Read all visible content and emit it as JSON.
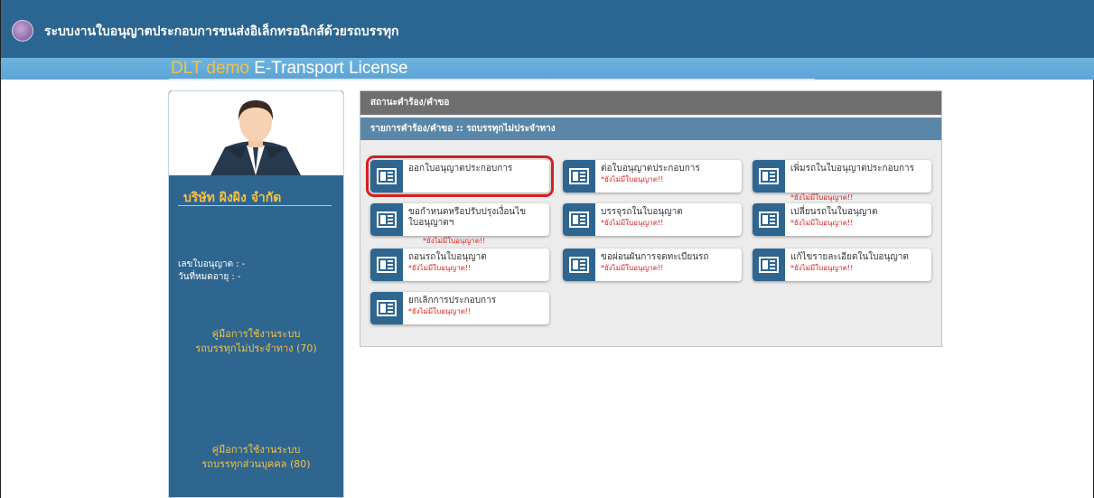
{
  "header": {
    "system_title": "ระบบงานใบอนุญาตประกอบการขนส่งอิเล็กทรอนิกส์ด้วยรถบรรทุก",
    "brand_demo": "DLT demo",
    "brand_rest": " E-Transport License"
  },
  "sidebar": {
    "company_name": "บริษัท ผิงผิง จำกัด",
    "license_no_label": "เลขใบอนุญาต : -",
    "expiry_label": "วันที่หมดอายุ : -",
    "manual1_line1": "คู่มือการใช้งานระบบ",
    "manual1_line2": "รถบรรทุกไม่ประจำทาง (70)",
    "manual2_line1": "คู่มือการใช้งานระบบ",
    "manual2_line2": "รถบรรทุกส่วนบุคคล (80)"
  },
  "panel": {
    "status_title": "สถานะคำร้อง/คำขอ",
    "list_title": "รายการคำร้อง/คำขอ :: รถบรรทุกไม่ประจำทาง"
  },
  "services": [
    {
      "label": "ออกใบอนุญาตประกอบการ",
      "note": ""
    },
    {
      "label": "ต่อใบอนุญาตประกอบการ",
      "note": "*ยังไม่มีใบอนุญาต!!"
    },
    {
      "label": "เพิ่มรถในใบอนุญาตประกอบการ",
      "note": "*ยังไม่มีใบอนุญาต!!"
    },
    {
      "label": "ขอกำหนดหรือปรับปรุงเงื่อนไขใบอนุญาตฯ",
      "note": "*ยังไม่มีใบอนุญาต!!"
    },
    {
      "label": "บรรจุรถในใบอนุญาต",
      "note": "*ยังไม่มีใบอนุญาต!!"
    },
    {
      "label": "เปลี่ยนรถในใบอนุญาต",
      "note": "*ยังไม่มีใบอนุญาต!!"
    },
    {
      "label": "ถอนรถในใบอนุญาต",
      "note": "*ยังไม่มีใบอนุญาต!!"
    },
    {
      "label": "ขอผ่อนผันการจดทะเบียนรถ",
      "note": "*ยังไม่มีใบอนุญาต!!"
    },
    {
      "label": "แก้ไขรายละเอียดในใบอนุญาต",
      "note": "*ยังไม่มีใบอนุญาต!!"
    },
    {
      "label": "ยกเลิกการประกอบการ",
      "note": "*ยังไม่มีใบอนุญาต!!"
    }
  ],
  "colors": {
    "header_bg": "#2b6591",
    "banner_bg": "#5aa4d6",
    "brand_accent": "#f5c242",
    "sidebar_bg": "#2f6690",
    "note_red": "#e02222",
    "selected_outline": "#d42020"
  },
  "icons": {
    "service": "document-card-icon",
    "logo": "emblem-logo-icon"
  }
}
